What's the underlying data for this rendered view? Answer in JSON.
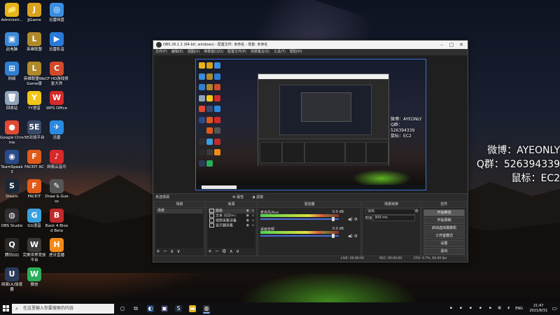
{
  "desktop": {
    "icons": [
      {
        "label": "Administr...",
        "col": 0,
        "row": 0,
        "color": "#e6b417",
        "glyph": "📁"
      },
      {
        "label": "JJGame",
        "col": 1,
        "row": 0,
        "color": "#d9a11c",
        "glyph": "J"
      },
      {
        "label": "迅雷网盘",
        "col": 2,
        "row": 0,
        "color": "#3a8fe0",
        "glyph": "◎"
      },
      {
        "label": "此电脑",
        "col": 0,
        "row": 1,
        "color": "#3c8bd8",
        "glyph": "▣"
      },
      {
        "label": "英雄联盟",
        "col": 1,
        "row": 1,
        "color": "#b08a2a",
        "glyph": "L"
      },
      {
        "label": "迅雷影音",
        "col": 2,
        "row": 1,
        "color": "#2a7ad8",
        "glyph": "▶"
      },
      {
        "label": "网络",
        "col": 0,
        "row": 2,
        "color": "#2f7fd0",
        "glyph": "⊞"
      },
      {
        "label": "英雄联盟WeGame版",
        "col": 1,
        "row": 2,
        "color": "#b08a2a",
        "glyph": "L"
      },
      {
        "label": "CF HD游戏修复大师",
        "col": 2,
        "row": 2,
        "color": "#d14a2a",
        "glyph": "C"
      },
      {
        "label": "回收站",
        "col": 0,
        "row": 3,
        "color": "#8fa4b8",
        "glyph": "🗑"
      },
      {
        "label": "YY语音",
        "col": 1,
        "row": 3,
        "color": "#f2c617",
        "glyph": "Y"
      },
      {
        "label": "WPS Office",
        "col": 2,
        "row": 3,
        "color": "#d42a2a",
        "glyph": "W"
      },
      {
        "label": "Google Chrome",
        "col": 0,
        "row": 4,
        "color": "#e04a33",
        "glyph": "●"
      },
      {
        "label": "5E对战平台",
        "col": 1,
        "row": 4,
        "color": "#3a4a6a",
        "glyph": "5E"
      },
      {
        "label": "迅雷",
        "col": 2,
        "row": 4,
        "color": "#2a8ae0",
        "glyph": "✈"
      },
      {
        "label": "TeamSpeak 3",
        "col": 0,
        "row": 5,
        "color": "#2a4a8a",
        "glyph": "◉"
      },
      {
        "label": "FACEIT AC",
        "col": 1,
        "row": 5,
        "color": "#e05a1a",
        "glyph": "F"
      },
      {
        "label": "网易云音乐",
        "col": 2,
        "row": 5,
        "color": "#d8282a",
        "glyph": "♪"
      },
      {
        "label": "Steam",
        "col": 0,
        "row": 6,
        "color": "#1b2838",
        "glyph": "S"
      },
      {
        "label": "FACEIT",
        "col": 1,
        "row": 6,
        "color": "#e05a1a",
        "glyph": "F"
      },
      {
        "label": "Draw & Guess",
        "col": 2,
        "row": 6,
        "color": "#555555",
        "glyph": "✎"
      },
      {
        "label": "OBS Studio",
        "col": 0,
        "row": 7,
        "color": "#302e31",
        "glyph": "◍"
      },
      {
        "label": "GG语音",
        "col": 1,
        "row": 7,
        "color": "#3aa0e0",
        "glyph": "G"
      },
      {
        "label": "Back 4 Blood Beta",
        "col": 2,
        "row": 7,
        "color": "#c02a2a",
        "glyph": "B"
      },
      {
        "label": "腾讯QQ",
        "col": 0,
        "row": 8,
        "color": "#2a2a2a",
        "glyph": "Q"
      },
      {
        "label": "完美世界竞技平台",
        "col": 1,
        "row": 8,
        "color": "#3a3a3a",
        "glyph": "W"
      },
      {
        "label": "虎牙直播",
        "col": 2,
        "row": 8,
        "color": "#f28a1a",
        "glyph": "H"
      },
      {
        "label": "网易UU加速器",
        "col": 0,
        "row": 9,
        "color": "#2a3a5a",
        "glyph": "U"
      },
      {
        "label": "微信",
        "col": 1,
        "row": 9,
        "color": "#2aae5a",
        "glyph": "W"
      }
    ]
  },
  "obs": {
    "title": "OBS 26.1.1 (64-bit, windows) - 配置文件: 未命名 - 场景: 未命名",
    "menu": [
      "文件(F)",
      "编辑(E)",
      "视图(V)",
      "停靠窗口(D)",
      "配置文件(P)",
      "场景集合(S)",
      "工具(T)",
      "帮助(H)"
    ],
    "context_bar": {
      "no_source": "未选择源",
      "properties": "属性",
      "filters": "滤镜"
    },
    "preview_overlay": [
      "微博：AYEONLY",
      "Q群：526394339",
      "鼠标：EC2"
    ],
    "docks": {
      "scenes": {
        "title": "场景",
        "items": [
          "场景"
        ],
        "footer": "+ − ∧ ∨"
      },
      "sources": {
        "title": "来源",
        "items": [
          {
            "label": "图像",
            "selected": true
          },
          {
            "label": "文本 (GDI+)",
            "selected": false
          },
          {
            "label": "视频采集设备",
            "selected": false
          },
          {
            "label": "显示器采集",
            "selected": false
          }
        ],
        "footer": "+ − ⚙ ∧ ∨"
      },
      "mixer": {
        "title": "混音器",
        "channels": [
          {
            "name": "麦克风/Aux",
            "db": "0.0 dB",
            "level": 0.82,
            "fader": 0.93
          },
          {
            "name": "桌面音频",
            "db": "0.0 dB",
            "level": 0.78,
            "fader": 0.93
          }
        ]
      },
      "transitions": {
        "title": "场景转换",
        "selected": "淡出",
        "duration_label": "时长",
        "duration": "300 ms"
      },
      "controls": {
        "title": "控件",
        "buttons": [
          "开始推流",
          "开始录制",
          "启动虚拟摄像机",
          "工作室模式",
          "设置",
          "退出"
        ]
      }
    },
    "status": {
      "live": "LIVE: 00:00:00",
      "rec": "REC: 00:00:00",
      "cpu": "CPU: 0.7%, 60.00 fps"
    }
  },
  "overlay": {
    "lines": [
      "微博：AYEONLY",
      "Q群：526394339",
      "鼠标：EC2"
    ]
  },
  "taskbar": {
    "search_placeholder": "在这里输入你要搜索的内容",
    "ime": "ENG",
    "time": "21:47",
    "date": "2021/8/31"
  }
}
